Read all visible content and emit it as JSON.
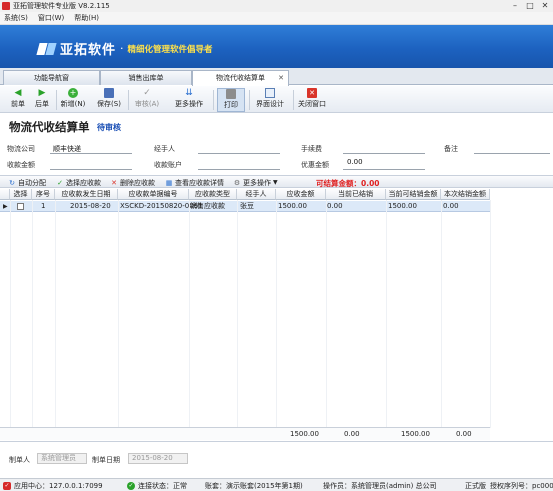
{
  "window": {
    "title": "亚拓管理软件专业版 V8.2.115",
    "minimize": "–",
    "maximize": "□",
    "close": "✕"
  },
  "menu": [
    "系统(S)",
    "窗口(W)",
    "帮助(H)"
  ],
  "banner": {
    "brand": "亚拓软件",
    "dot": "·",
    "slogan": "精细化管理软件倡导者"
  },
  "tabs": [
    {
      "label": "功能导航窗",
      "active": false
    },
    {
      "label": "销售出库单",
      "active": false
    },
    {
      "label": "物流代收结算单",
      "active": true
    }
  ],
  "tab_close": "✕",
  "toolbar": {
    "prev": "前单",
    "next": "后单",
    "add": "新增(N)",
    "save": "保存(S)",
    "review": "审核(A)",
    "more": "更多操作",
    "print": "打印",
    "design": "界面设计",
    "close": "关闭窗口"
  },
  "form": {
    "title": "物流代收结算单",
    "status": "待审核",
    "labels": {
      "logistics": "物流公司",
      "handler": "经手人",
      "fee": "手续费",
      "remark": "备注",
      "amount": "收款金额",
      "account": "收款账户",
      "discount": "优惠金额"
    },
    "values": {
      "logistics": "顺丰快递",
      "discount": "0.00"
    }
  },
  "grid_tools": {
    "auto": "自动分配",
    "select": "选择应收款",
    "delete": "删除应收款",
    "view": "查看应收款详情",
    "more": "更多操作",
    "payable_label": "可结算金额：",
    "payable_value": "0.00"
  },
  "columns": [
    "选择",
    "序号",
    "应收款发生日期",
    "应收款单据编号",
    "应收款类型",
    "经手人",
    "应收金额",
    "当前已结销",
    "当前可结销金额",
    "本次结销金额"
  ],
  "rows": [
    {
      "seq": "1",
      "date": "2015-08-20",
      "doc": "XSCKD-20150820-0061",
      "type": "销售应收款",
      "handler": "张豆",
      "amount": "1500.00",
      "settled": "0.00",
      "settleable": "1500.00",
      "current": "0.00"
    }
  ],
  "totals": {
    "amount": "1500.00",
    "settled": "0.00",
    "settleable": "1500.00",
    "current": "0.00"
  },
  "maker": {
    "label": "制单人",
    "value": "系统管理员",
    "date_label": "制单日期",
    "date_value": "2015-08-20"
  },
  "statusbar": {
    "center": "应用中心：127.0.0.1:7099",
    "conn": "连接状态：正常",
    "account": "账套：演示账套(2015年第1期)",
    "operator": "操作员：系统管理员(admin) 总公司",
    "edition": "正式版",
    "license": "授权序列号：pc0001"
  }
}
